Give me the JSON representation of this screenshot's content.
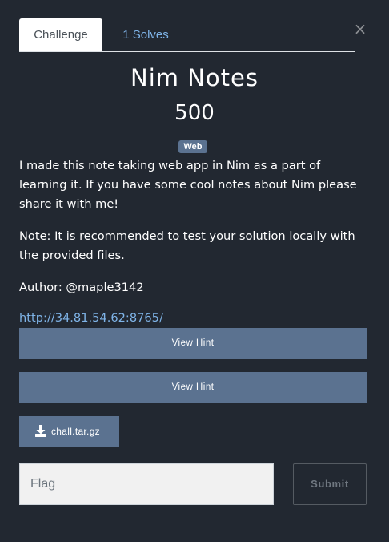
{
  "tabs": [
    {
      "label": "Challenge",
      "active": true
    },
    {
      "label": "1 Solves",
      "active": false
    }
  ],
  "close_label": "×",
  "challenge": {
    "name": "Nim Notes",
    "points": "500",
    "category": "Web",
    "description": [
      "I made this note taking web app in Nim as a part of learning it. If you have some cool notes about Nim please share it with me!",
      "Note: It is recommended to test your solution locally with the provided files.",
      "Author: @maple3142"
    ],
    "link": "http://34.81.54.62:8765/"
  },
  "hints": [
    {
      "label": "View Hint"
    },
    {
      "label": "View Hint"
    }
  ],
  "file": {
    "name": "chall.tar.gz",
    "icon": "download-icon"
  },
  "flag_form": {
    "placeholder": "Flag",
    "value": "",
    "submit_label": "Submit"
  },
  "colors": {
    "background": "#222831",
    "accent": "#5b7290",
    "link": "#7fb4e8"
  }
}
